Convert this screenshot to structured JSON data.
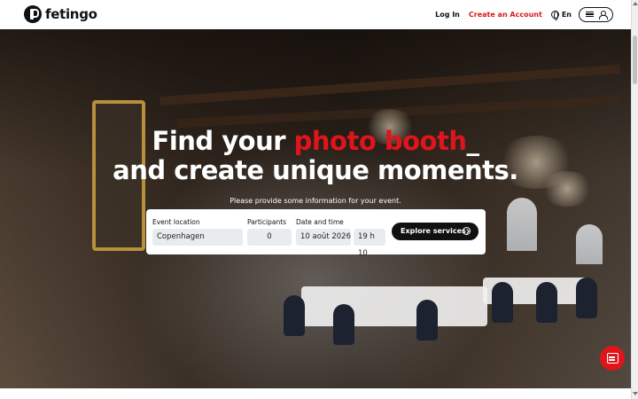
{
  "brand": {
    "name": "fetingo"
  },
  "nav": {
    "login": "Log In",
    "create_account": "Create an Account",
    "language": "En"
  },
  "hero": {
    "headline_part1": "Find your ",
    "headline_highlight": "photo booth",
    "headline_cursor": "_",
    "headline_line2": "and create unique moments.",
    "subtitle": "Please provide some information for your event."
  },
  "search": {
    "location_label": "Event location",
    "location_value": "Copenhagen",
    "participants_label": "Participants",
    "participants_value": "0",
    "datetime_label": "Date and time",
    "date_value": "10 août 2026",
    "time_value": "19 h 10",
    "explore_label": "Explore services"
  },
  "colors": {
    "accent": "#e0151c",
    "dark": "#111111"
  },
  "icons": [
    "logo-icon",
    "globe-icon",
    "menu-icon",
    "user-icon",
    "arrow-right-circle-icon",
    "chat-icon"
  ]
}
